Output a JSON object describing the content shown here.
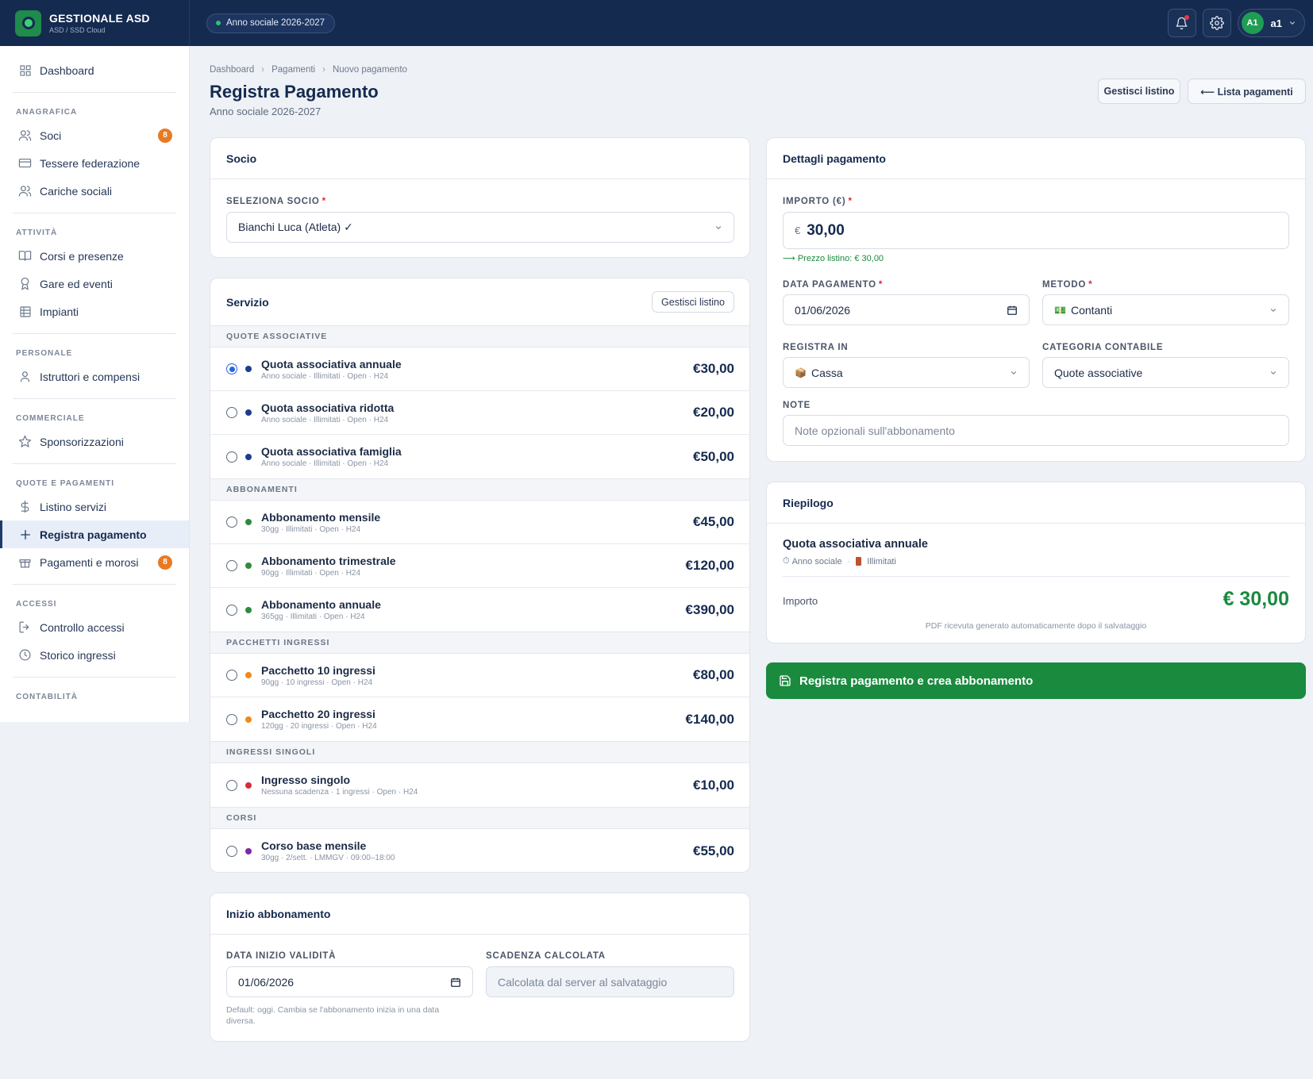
{
  "topbar": {
    "brand_title": "GESTIONALE ASD",
    "brand_sub": "ASD / SSD Cloud",
    "year_pill": "Anno sociale 2026-2027",
    "user_initials": "A1",
    "user_name": "a1"
  },
  "sidebar": {
    "dashboard": "Dashboard",
    "sections": {
      "anagrafica": "ANAGRAFICA",
      "attivita": "ATTIVITÀ",
      "personale": "PERSONALE",
      "commerciale": "COMMERCIALE",
      "quote": "QUOTE E PAGAMENTI",
      "accessi": "ACCESSI",
      "contabilita": "CONTABILITÀ"
    },
    "items": {
      "soci": "Soci",
      "soci_badge": "8",
      "tessere": "Tessere federazione",
      "cariche": "Cariche sociali",
      "corsi": "Corsi e presenze",
      "gare": "Gare ed eventi",
      "impianti": "Impianti",
      "istruttori": "Istruttori e compensi",
      "sponsor": "Sponsorizzazioni",
      "listino": "Listino servizi",
      "registra": "Registra pagamento",
      "pagamenti": "Pagamenti e morosi",
      "pagamenti_badge": "8",
      "controllo": "Controllo accessi",
      "storico": "Storico ingressi"
    }
  },
  "breadcrumb": [
    "Dashboard",
    "Pagamenti",
    "Nuovo pagamento"
  ],
  "page": {
    "title": "Registra Pagamento",
    "subtitle": "Anno sociale 2026-2027",
    "btn_listino": "Gestisci listino",
    "btn_lista": "⟵ Lista pagamenti"
  },
  "socio": {
    "title": "Socio",
    "label": "SELEZIONA SOCIO",
    "value": "Bianchi Luca (Atleta) ✓"
  },
  "servizio": {
    "title": "Servizio",
    "btn": "Gestisci listino",
    "sections": {
      "quote": "QUOTE ASSOCIATIVE",
      "abbonamenti": "ABBONAMENTI",
      "pacchetti": "PACCHETTI INGRESSI",
      "singoli": "INGRESSI SINGOLI",
      "corsi": "CORSI"
    },
    "rows": [
      {
        "name": "Quota associativa annuale",
        "meta": "Anno sociale · Illimitati · Open · H24",
        "price": "€30,00",
        "color": "#1f3b8f"
      },
      {
        "name": "Quota associativa ridotta",
        "meta": "Anno sociale · Illimitati · Open · H24",
        "price": "€20,00",
        "color": "#1f3b8f"
      },
      {
        "name": "Quota associativa famiglia",
        "meta": "Anno sociale · Illimitati · Open · H24",
        "price": "€50,00",
        "color": "#1f3b8f"
      },
      {
        "name": "Abbonamento mensile",
        "meta": "30gg · Illimitati · Open · H24",
        "price": "€45,00",
        "color": "#2e8b3e"
      },
      {
        "name": "Abbonamento trimestrale",
        "meta": "90gg · Illimitati · Open · H24",
        "price": "€120,00",
        "color": "#2e8b3e"
      },
      {
        "name": "Abbonamento annuale",
        "meta": "365gg · Illimitati · Open · H24",
        "price": "€390,00",
        "color": "#2e8b3e"
      },
      {
        "name": "Pacchetto 10 ingressi",
        "meta": "90gg · 10 ingressi · Open · H24",
        "price": "€80,00",
        "color": "#ef8a17"
      },
      {
        "name": "Pacchetto 20 ingressi",
        "meta": "120gg · 20 ingressi · Open · H24",
        "price": "€140,00",
        "color": "#ef8a17"
      },
      {
        "name": "Ingresso singolo",
        "meta": "Nessuna scadenza · 1 ingressi · Open · H24",
        "price": "€10,00",
        "color": "#d62c3a"
      },
      {
        "name": "Corso base mensile",
        "meta": "30gg · 2/sett. · LMMGV · 09:00–18:00",
        "price": "€55,00",
        "color": "#7a2aa8"
      }
    ]
  },
  "inizio": {
    "title": "Inizio abbonamento",
    "label_data": "DATA INIZIO VALIDITÀ",
    "data_value": "01/06/2026",
    "hint": "Default: oggi. Cambia se l'abbonamento inizia in una data diversa.",
    "label_scadenza": "SCADENZA CALCOLATA",
    "scadenza_value": "Calcolata dal server al salvataggio"
  },
  "dettagli": {
    "title": "Dettagli pagamento",
    "label_importo": "IMPORTO (€)",
    "currency": "€",
    "importo": "30,00",
    "prezzo_listino": "⟶ Prezzo listino: € 30,00",
    "label_data": "DATA PAGAMENTO",
    "data_value": "01/06/2026",
    "label_metodo": "METODO",
    "metodo_icon": "💵",
    "metodo_value": "Contanti",
    "label_registra": "REGISTRA IN",
    "registra_icon": "📦",
    "registra_value": "Cassa",
    "label_categoria": "CATEGORIA CONTABILE",
    "categoria_value": "Quote associative",
    "label_note": "NOTE",
    "note_placeholder": "Note opzionali sull'abbonamento"
  },
  "riepilogo": {
    "title": "Riepilogo",
    "servizio": "Quota associativa annuale",
    "tag1_icon": "⏱",
    "tag1": "Anno sociale",
    "tag2": "Illimitati",
    "importo_label": "Importo",
    "importo_value": "€ 30,00",
    "pdf_note": "PDF ricevuta generato automaticamente dopo il salvataggio"
  },
  "submit": {
    "label": "Registra pagamento e crea abbonamento"
  },
  "colors": {
    "navy": "#152a4f",
    "green": "#1a8a3f",
    "badge": "#e97a22"
  }
}
